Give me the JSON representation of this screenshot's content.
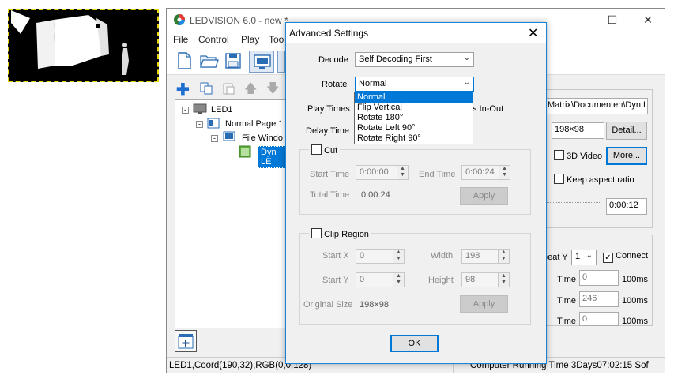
{
  "app": {
    "title": "LEDVISION 6.0 - new *",
    "menu": [
      "File",
      "Control",
      "Play",
      "Too"
    ],
    "tree": {
      "root": "LED1",
      "page": "Normal Page 1",
      "window": "File Windo",
      "file": "Dyn LE"
    },
    "right_panel": {
      "path": "Matrix\\Documenten\\Dyn LE",
      "size_label_fragment": "e",
      "size_value": "198×98",
      "detail_button": "Detail...",
      "video3d_label": "3D Video",
      "more_button": "More...",
      "keep_aspect_label": "Keep aspect ratio",
      "time_value": "0:00:12",
      "repeat_label": "peat Y",
      "repeat_value": "1",
      "connect_label": "Connect",
      "rows": [
        {
          "label": "Time",
          "value": "0",
          "unit": "100ms"
        },
        {
          "label": "Time",
          "value": "246",
          "unit": "100ms"
        },
        {
          "label": "Time",
          "value": "0",
          "unit": "100ms"
        }
      ]
    },
    "status": {
      "left": "LED1,Coord(190,32),RGB(0,0,128)",
      "right": "Computer Running Time 3Days07:02:15 Sof"
    }
  },
  "dialog": {
    "title": "Advanced Settings",
    "decode_label": "Decode",
    "decode_value": "Self Decoding First",
    "rotate_label": "Rotate",
    "rotate_value": "Normal",
    "rotate_options": [
      "Normal",
      "Flip Vertical",
      "Rotate 180°",
      "Rotate Left 90°",
      "Rotate Right 90°"
    ],
    "play_times_label": "Play Times",
    "play_times_fragment": "s In-Out",
    "delay_time_label": "Delay Time",
    "cut": {
      "label": "Cut",
      "start_label": "Start Time",
      "start_value": "0:00:00",
      "end_label": "End Time",
      "end_value": "0:00:24",
      "total_label": "Total Time",
      "total_value": "0:00:24",
      "apply": "Apply"
    },
    "clip": {
      "label": "Clip Region",
      "startx_label": "Start X",
      "startx_value": "0",
      "width_label": "Width",
      "width_value": "198",
      "starty_label": "Start Y",
      "starty_value": "0",
      "height_label": "Height",
      "height_value": "98",
      "orig_label": "Original Size",
      "orig_value": "198×98",
      "apply": "Apply"
    },
    "ok": "OK"
  }
}
